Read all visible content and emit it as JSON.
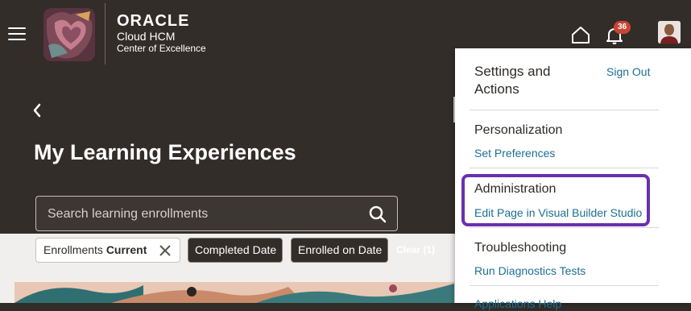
{
  "header": {
    "brand_main": "ORACLE",
    "brand_product": "Cloud HCM",
    "brand_sub": "Center of Excellence",
    "notification_count": "36",
    "icons": [
      "menu-icon",
      "home-icon",
      "bell-icon",
      "avatar"
    ]
  },
  "page": {
    "back_icon": "chevron-left-icon",
    "title": "My Learning Experiences"
  },
  "search": {
    "placeholder": "Search learning enrollments",
    "value": ""
  },
  "filters": {
    "active_chip_label": "Enrollments",
    "active_chip_value": "Current",
    "chips": [
      "Completed Date",
      "Enrolled on Date"
    ],
    "clear_label": "Clear (1)"
  },
  "settings_panel": {
    "title": "Settings and Actions",
    "sign_out": "Sign Out",
    "sections": [
      {
        "heading": "Personalization",
        "link": "Set Preferences"
      },
      {
        "heading": "Administration",
        "link": "Edit Page in Visual Builder Studio"
      },
      {
        "heading": "Troubleshooting",
        "link": "Run Diagnostics Tests"
      }
    ],
    "cutoff_link": "Applications Help"
  },
  "colors": {
    "header_bg": "#332d2a",
    "link": "#1d6f92",
    "badge": "#c74634",
    "highlight": "#6a2fb0"
  }
}
